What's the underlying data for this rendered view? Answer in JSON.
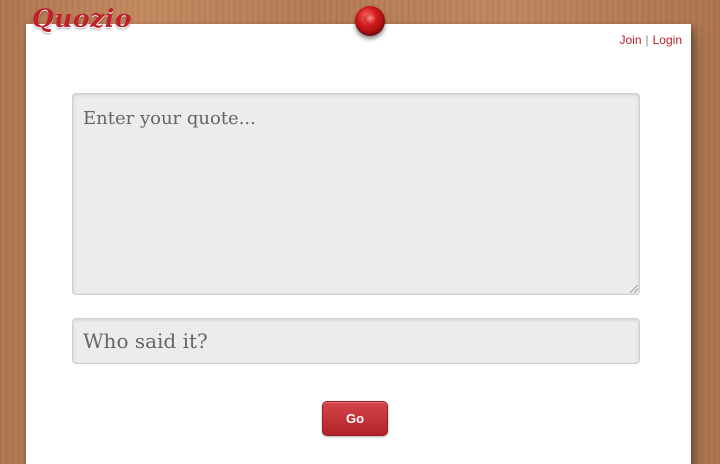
{
  "brand": {
    "logo_text": "Quozio"
  },
  "auth": {
    "join_label": "Join",
    "separator": "|",
    "login_label": "Login"
  },
  "form": {
    "quote_placeholder": "Enter your quote...",
    "author_placeholder": "Who said it?",
    "go_label": "Go"
  },
  "colors": {
    "brand_red": "#c0212b",
    "button_red": "#c4323a",
    "field_bg": "#ececec"
  },
  "icons": {
    "pin": "pushpin-icon",
    "resize": "resize-grip-icon"
  }
}
